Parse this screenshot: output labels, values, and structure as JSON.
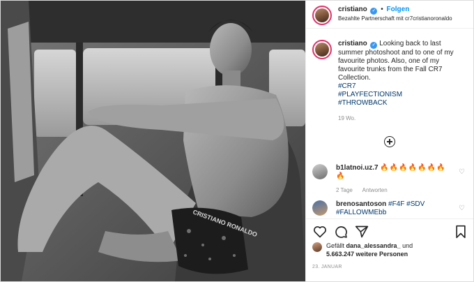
{
  "header": {
    "username": "cristiano",
    "follow_label": "Folgen",
    "separator": "•",
    "partnership": "Bezahlte Partnerschaft mit cr7cristianoronaldo"
  },
  "caption": {
    "username": "cristiano",
    "text": "Looking back to last summer photoshoot and to one of my favourite photos. Also, one of my favourite trunks from the Fall CR7 Collection.",
    "hashtags": [
      "#CR7",
      "#PLAYFECTIONISM",
      "#THROWBACK"
    ],
    "time_ago": "19 Wo."
  },
  "comments": [
    {
      "username": "b1latnoi.uz.7",
      "text": "🔥🔥🔥🔥🔥🔥🔥🔥",
      "time": "2 Tage",
      "reply_label": "Antworten"
    },
    {
      "username": "brenosantoson",
      "text": "#F4F #SDV #FALLOWMEbb"
    }
  ],
  "likes": {
    "liked_by_prefix": "Gefällt ",
    "liked_by_user": "dana_alessandra_",
    "and_label": " und",
    "count_text": "5.663.247 weitere Personen"
  },
  "date": "23. JANUAR",
  "photo": {
    "trunks_text": "CRISTIANO RONALDO"
  },
  "icons": [
    "verified-badge-icon",
    "load-more-comments-icon",
    "heart-icon",
    "comment-icon",
    "share-icon",
    "bookmark-icon"
  ],
  "colors": {
    "accent": "#0095f6",
    "hashtag": "#00376b",
    "muted": "#8e8e8e",
    "story_ring": "#e1306c"
  }
}
